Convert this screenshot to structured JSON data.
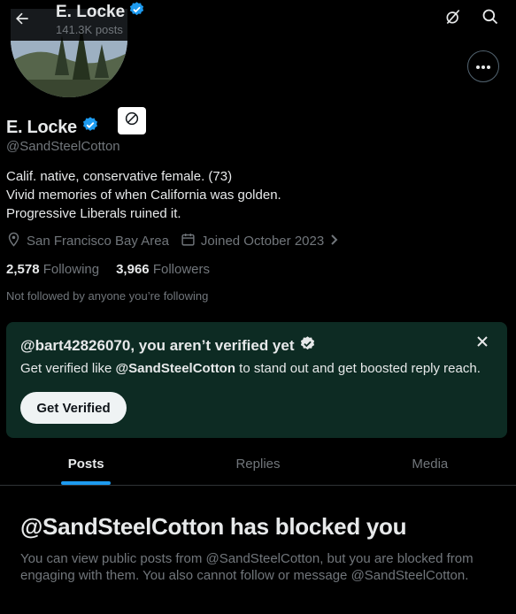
{
  "header": {
    "name": "E. Locke",
    "post_count": "141.3K posts"
  },
  "profile": {
    "display_name": "E. Locke",
    "handle": "@SandSteelCotton",
    "bio_lines": [
      "Calif. native, conservative female. (73)",
      "Vivid memories of when California was golden.",
      "Progressive Liberals ruined it."
    ],
    "location": "San Francisco Bay Area",
    "joined": "Joined October 2023",
    "following_count": "2,578",
    "following_label": "Following",
    "followers_count": "3,966",
    "followers_label": "Followers",
    "not_followed": "Not followed by anyone you’re following"
  },
  "verify_card": {
    "title": "@bart42826070, you aren’t verified yet",
    "body_prefix": "Get verified like ",
    "body_handle": "@SandSteelCotton",
    "body_suffix": " to stand out and get boosted reply reach.",
    "button": "Get Verified"
  },
  "tabs": [
    {
      "label": "Posts",
      "active": true
    },
    {
      "label": "Replies",
      "active": false
    },
    {
      "label": "Media",
      "active": false
    }
  ],
  "blocked": {
    "title": "@SandSteelCotton has blocked you",
    "description": "You can view public posts from @SandSteelCotton, but you are blocked from engaging with them. You also cannot follow or message @SandSteelCotton."
  },
  "colors": {
    "accent": "#1d9bf0",
    "muted": "#71767b",
    "card_bg": "#0d2b23",
    "background": "#000000"
  },
  "icons": [
    "back-arrow-icon",
    "grok-icon",
    "search-icon",
    "more-icon",
    "verified-badge-icon",
    "blocked-icon",
    "location-icon",
    "calendar-icon",
    "chevron-right-icon",
    "close-icon"
  ]
}
